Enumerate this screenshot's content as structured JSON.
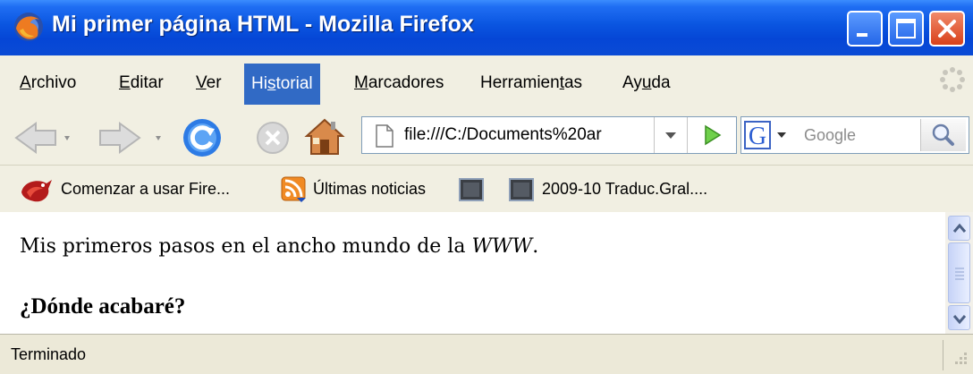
{
  "window": {
    "title": "Mi primer página HTML - Mozilla Firefox",
    "buttons": {
      "minimize": "minimize-icon",
      "maximize": "maximize-icon",
      "close": "close-icon"
    }
  },
  "menubar": {
    "items": [
      {
        "label": "Archivo",
        "underline": "A"
      },
      {
        "label": "Editar",
        "underline": "E"
      },
      {
        "label": "Ver",
        "underline": "V"
      },
      {
        "label": "Historial",
        "underline": "s",
        "active": true
      },
      {
        "label": "Marcadores",
        "underline": "M"
      },
      {
        "label": "Herramientas",
        "underline": "t"
      },
      {
        "label": "Ayuda",
        "underline": "u"
      }
    ]
  },
  "navbar": {
    "url": "file:///C:/Documents%20ar",
    "search_placeholder": "Google",
    "search_engine": "G"
  },
  "bookmarks": {
    "items": [
      {
        "label": "Comenzar a usar Fire...",
        "icon": "firefox-icon"
      },
      {
        "label": "Últimas noticias",
        "icon": "rss-icon"
      },
      {
        "label": "",
        "icon": "bookmark-icon"
      },
      {
        "label": "2009-10 Traduc.Gral....",
        "icon": "bookmark-icon"
      }
    ]
  },
  "page": {
    "paragraph_text": "Mis primeros pasos en el ancho mundo de la ",
    "paragraph_emphasis": "WWW",
    "paragraph_end": ".",
    "heading": "¿Dónde acabaré?"
  },
  "status": {
    "text": "Terminado"
  },
  "colors": {
    "titlebar": "#0546d6",
    "menu_highlight": "#316ac5",
    "chrome": "#ece9d8"
  }
}
